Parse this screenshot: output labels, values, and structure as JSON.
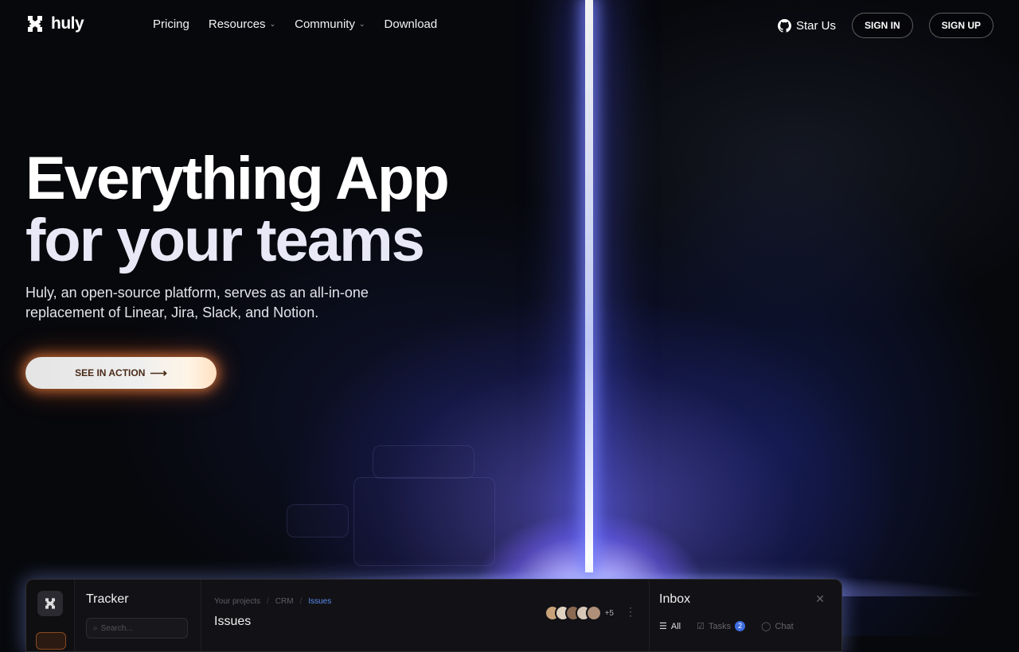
{
  "nav": {
    "brand": "huly",
    "links": [
      {
        "label": "Pricing",
        "has_menu": false
      },
      {
        "label": "Resources",
        "has_menu": true
      },
      {
        "label": "Community",
        "has_menu": true
      },
      {
        "label": "Download",
        "has_menu": false
      }
    ],
    "star_label": "Star Us",
    "sign_in": "SIGN IN",
    "sign_up": "SIGN UP"
  },
  "hero": {
    "title_line1": "Everything App",
    "title_line2": "for your teams",
    "subtitle": "Huly, an open-source platform, serves as an all-in-one replacement of Linear, Jira, Slack, and Notion.",
    "cta_label": "SEE IN ACTION",
    "cta_arrow": "⟶"
  },
  "app_preview": {
    "sidebar_title": "Tracker",
    "search_placeholder": "Search...",
    "breadcrumb": [
      "Your projects",
      "CRM",
      "Issues"
    ],
    "main_title": "Issues",
    "avatar_more": "+5",
    "inbox_title": "Inbox",
    "inbox_tabs": [
      {
        "label": "All",
        "active": true
      },
      {
        "label": "Tasks",
        "badge": "2"
      },
      {
        "label": "Chat"
      }
    ]
  },
  "colors": {
    "accent_blue": "#5b8cf0",
    "cta_glow": "#ff8c46",
    "beam": "#7882ff"
  }
}
